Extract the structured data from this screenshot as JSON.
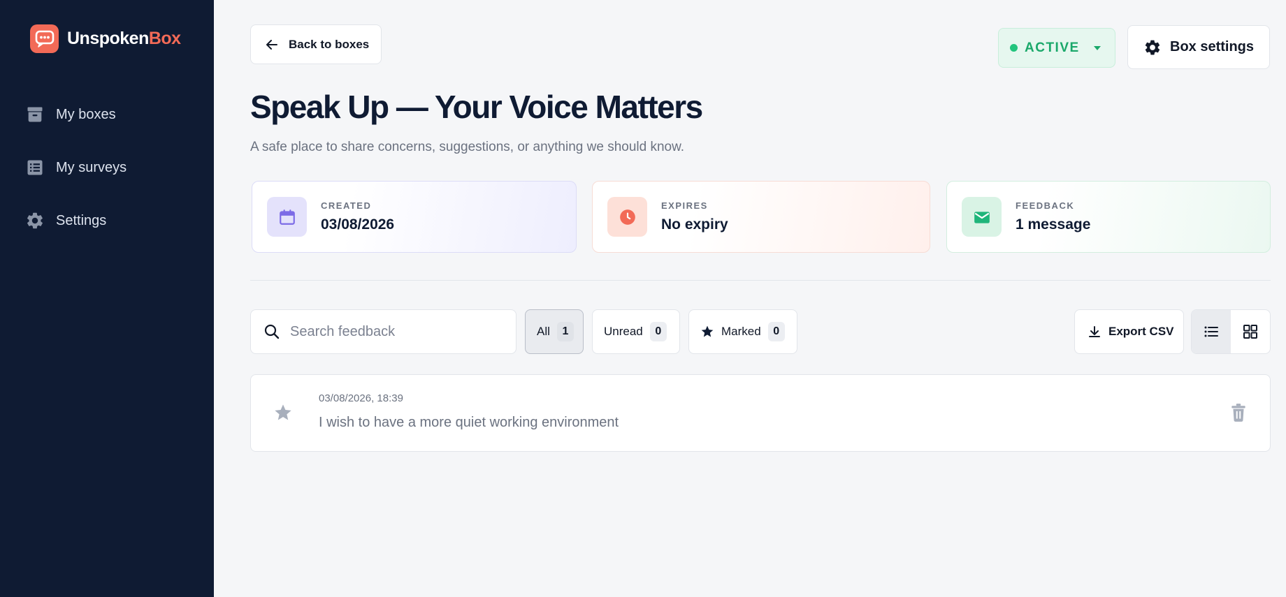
{
  "brand": {
    "name_part1": "Unspoken",
    "name_part2": "Box",
    "accent": "#f26a57"
  },
  "sidebar": {
    "items": [
      {
        "label": "My boxes",
        "icon": "archive-icon"
      },
      {
        "label": "My surveys",
        "icon": "list-icon"
      },
      {
        "label": "Settings",
        "icon": "gear-icon"
      }
    ]
  },
  "header": {
    "back_label": "Back to boxes",
    "status_label": "ACTIVE",
    "settings_label": "Box settings"
  },
  "box": {
    "title": "Speak Up — Your Voice Matters",
    "subtitle": "A safe place to share concerns, suggestions, or anything we should know."
  },
  "stats": {
    "created": {
      "label": "CREATED",
      "value": "03/08/2026"
    },
    "expires": {
      "label": "EXPIRES",
      "value": "No expiry"
    },
    "feedback": {
      "label": "FEEDBACK",
      "value": "1 message"
    }
  },
  "toolbar": {
    "search_placeholder": "Search feedback",
    "filters": {
      "all": {
        "label": "All",
        "count": "1"
      },
      "unread": {
        "label": "Unread",
        "count": "0"
      },
      "marked": {
        "label": "Marked",
        "count": "0"
      }
    },
    "export_label": "Export CSV"
  },
  "feedback": [
    {
      "timestamp": "03/08/2026, 18:39",
      "text": "I wish to have a more quiet working environment"
    }
  ],
  "colors": {
    "sidebar_bg": "#0f1b33",
    "status_green": "#1aa86a",
    "created_icon": "#7c6be6",
    "expires_icon": "#f26a57",
    "feedback_icon": "#1fb57a"
  }
}
